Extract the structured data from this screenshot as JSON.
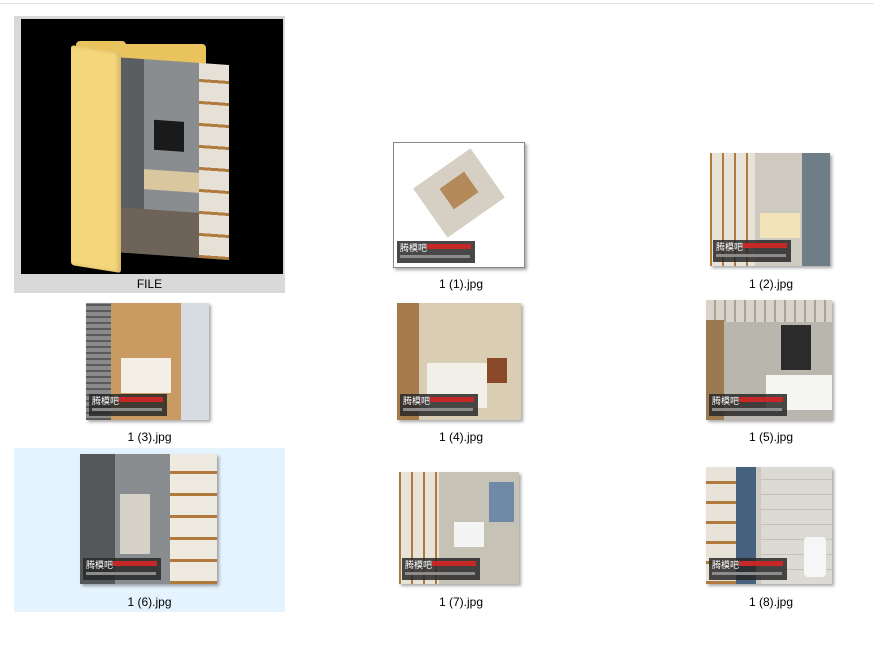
{
  "folder": {
    "name": "FILE",
    "icon": "folder-icon"
  },
  "files": [
    {
      "name": "1 (1).jpg",
      "watermark": "腾模吧"
    },
    {
      "name": "1 (2).jpg",
      "watermark": "腾模吧"
    },
    {
      "name": "1 (3).jpg",
      "watermark": "腾模吧"
    },
    {
      "name": "1 (4).jpg",
      "watermark": "腾模吧"
    },
    {
      "name": "1 (5).jpg",
      "watermark": "腾模吧"
    },
    {
      "name": "1 (6).jpg",
      "watermark": "腾模吧"
    },
    {
      "name": "1 (7).jpg",
      "watermark": "腾模吧"
    },
    {
      "name": "1 (8).jpg",
      "watermark": "腾模吧"
    }
  ],
  "colors": {
    "folder_selected_bg": "#d9d9d9",
    "file_selected_bg": "#e5f3ff",
    "folder_yellow": "#f6d67a"
  }
}
